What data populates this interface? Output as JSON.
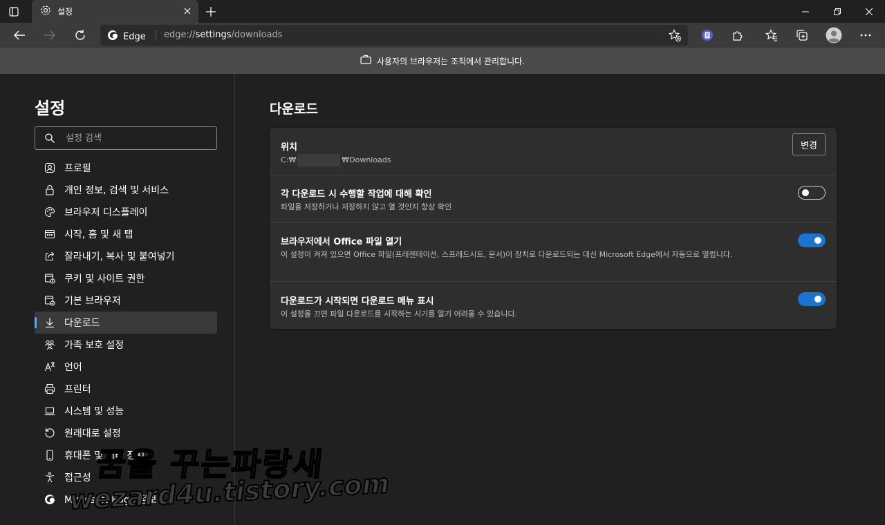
{
  "tab": {
    "title": "설정"
  },
  "addressbar": {
    "site_label": "Edge",
    "url_prefix": "edge://",
    "url_strong": "settings",
    "url_suffix": "/downloads"
  },
  "banner": {
    "text": "사용자의 브라우저는 조직에서 관리합니다."
  },
  "sidebar": {
    "title": "설정",
    "search_placeholder": "설정 검색",
    "items": [
      {
        "label": "프로필",
        "icon": "profile-icon"
      },
      {
        "label": "개인 정보, 검색 및 서비스",
        "icon": "lock-icon"
      },
      {
        "label": "브라우저 디스플레이",
        "icon": "palette-icon"
      },
      {
        "label": "시작, 홈 및 새 탭",
        "icon": "home-tab-icon"
      },
      {
        "label": "잘라내기, 복사 및 붙여넣기",
        "icon": "share-icon"
      },
      {
        "label": "쿠키 및 사이트 권한",
        "icon": "site-permissions-icon"
      },
      {
        "label": "기본 브라우저",
        "icon": "default-browser-icon"
      },
      {
        "label": "다운로드",
        "icon": "download-icon",
        "active": true
      },
      {
        "label": "가족 보호 설정",
        "icon": "family-icon"
      },
      {
        "label": "언어",
        "icon": "language-icon"
      },
      {
        "label": "프린터",
        "icon": "printer-icon"
      },
      {
        "label": "시스템 및 성능",
        "icon": "laptop-icon"
      },
      {
        "label": "원래대로 설정",
        "icon": "reset-icon"
      },
      {
        "label": "휴대폰 및 기타 장치",
        "icon": "phone-icon"
      },
      {
        "label": "접근성",
        "icon": "accessibility-icon"
      },
      {
        "label": "Microsoft Edge 정보",
        "icon": "edge-logo-icon"
      }
    ]
  },
  "main": {
    "title": "다운로드",
    "location": {
      "title": "위치",
      "path_prefix": "C:₩",
      "path_suffix": "₩Downloads",
      "button": "변경"
    },
    "ask_each": {
      "title": "각 다운로드 시 수행할 작업에 대해 확인",
      "desc": "파일을 저장하거나 저장하지 않고 열 것인지 항상 확인",
      "enabled": false
    },
    "open_office": {
      "title": "브라우저에서 Office 파일 열기",
      "desc": "이 설정이 켜져 있으면 Office 파일(프레젠테이션, 스프레드시트, 문서)이 장치로 다운로드되는 대신 Microsoft Edge에서 자동으로 열립니다.",
      "enabled": true
    },
    "show_menu": {
      "title": "다운로드가 시작되면 다운로드 메뉴 표시",
      "desc": "이 설정을 끄면 파일 다운로드를 시작하는 시기를 알기 어려울 수 있습니다.",
      "enabled": true
    }
  },
  "watermark": {
    "line1": "꿈을 꾸는파랑새",
    "line2": "wezard4u.tistory.com"
  },
  "colors": {
    "accent": "#1b74cf",
    "background": "#202020",
    "card": "#2e2e2e",
    "toolbar": "#3b3b3b"
  }
}
